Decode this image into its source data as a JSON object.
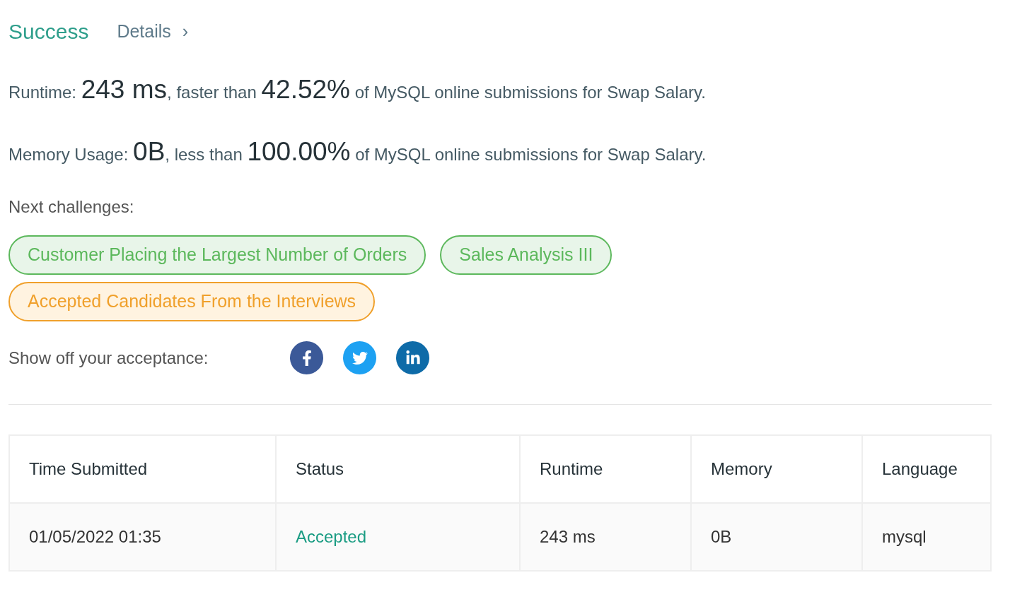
{
  "header": {
    "status": "Success",
    "details_link": "Details",
    "details_chevron": "›"
  },
  "stats": [
    {
      "label": "Runtime:",
      "value": "243 ms",
      "comparison": ", faster than",
      "percent": "42.52%",
      "suffix": "of MySQL online submissions for Swap Salary."
    },
    {
      "label": "Memory Usage:",
      "value": "0B",
      "comparison": ", less than",
      "percent": "100.00%",
      "suffix": "of MySQL online submissions for Swap Salary."
    }
  ],
  "next_challenges": {
    "label": "Next challenges:",
    "items": [
      {
        "title": "Customer Placing the Largest Number of Orders",
        "kind": "easy"
      },
      {
        "title": "Sales Analysis III",
        "kind": "easy"
      },
      {
        "title": "Accepted Candidates From the Interviews",
        "kind": "medium"
      }
    ]
  },
  "share": {
    "label": "Show off your acceptance:",
    "networks": [
      {
        "kind": "facebook"
      },
      {
        "kind": "twitter"
      },
      {
        "kind": "linkedin"
      }
    ]
  },
  "table": {
    "columns": [
      "Time Submitted",
      "Status",
      "Runtime",
      "Memory",
      "Language"
    ],
    "rows": [
      {
        "cells": [
          "01/05/2022 01:35",
          "Accepted",
          "243 ms",
          "0B",
          "mysql"
        ],
        "kind": "accepted"
      }
    ]
  }
}
